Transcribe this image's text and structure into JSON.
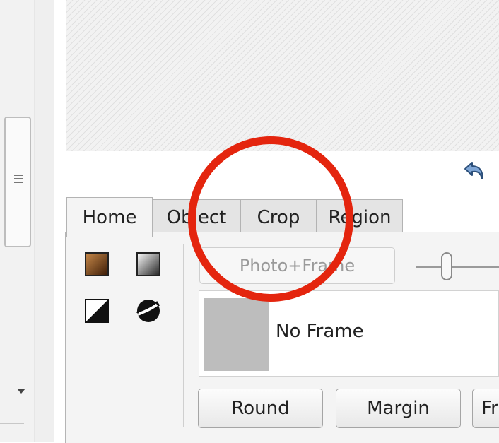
{
  "tabs": [
    {
      "label": "Home",
      "active": true
    },
    {
      "label": "Object",
      "active": false
    },
    {
      "label": "Crop",
      "active": false
    },
    {
      "label": "Region",
      "active": false
    }
  ],
  "toolbar": {
    "photo_frame_label": "Photo+Frame",
    "slider_value": 0.3
  },
  "frame_list": {
    "items": [
      {
        "label": "No Frame"
      }
    ]
  },
  "buttons": {
    "round": "Round",
    "margin": "Margin",
    "frame_partial": "Fr"
  },
  "icons": [
    "undo-icon",
    "scroll-grip-icon",
    "scroll-down-icon"
  ],
  "colors": {
    "highlight_circle": "#e4250e",
    "frame_thumb": "#bdbdbd"
  }
}
